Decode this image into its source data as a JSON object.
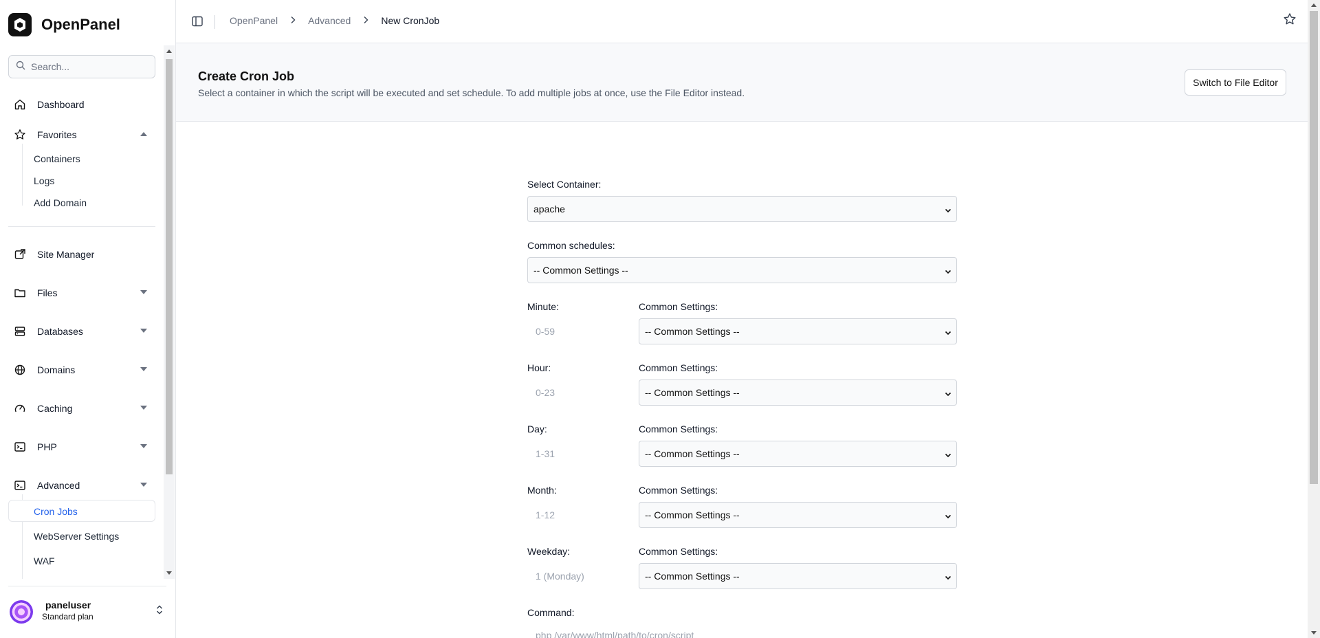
{
  "brand": {
    "name": "OpenPanel",
    "icon": "openpanel-logo-icon"
  },
  "search": {
    "placeholder": "Search..."
  },
  "nav": {
    "dashboard": "Dashboard",
    "favorites": "Favorites",
    "favorites_items": [
      "Containers",
      "Logs",
      "Add Domain"
    ],
    "site_manager": "Site Manager",
    "files": "Files",
    "databases": "Databases",
    "domains": "Domains",
    "caching": "Caching",
    "php": "PHP",
    "advanced": "Advanced",
    "advanced_items": [
      "Cron Jobs",
      "WebServer Settings",
      "WAF"
    ]
  },
  "user": {
    "name": "paneluser",
    "plan": "Standard plan"
  },
  "breadcrumb": [
    "OpenPanel",
    "Advanced",
    "New CronJob"
  ],
  "header": {
    "title": "Create Cron Job",
    "description": "Select a container in which the script will be executed and set schedule. To add multiple jobs at once, use the File Editor instead.",
    "switch_button": "Switch to File Editor"
  },
  "form": {
    "container_label": "Select Container:",
    "container_value": "apache",
    "common_schedules_label": "Common schedules:",
    "common_schedules_value": "-- Common Settings --",
    "common_settings_label": "Common Settings:",
    "common_settings_value": "-- Common Settings --",
    "minute": {
      "label": "Minute:",
      "placeholder": "0-59"
    },
    "hour": {
      "label": "Hour:",
      "placeholder": "0-23"
    },
    "day": {
      "label": "Day:",
      "placeholder": "1-31"
    },
    "month": {
      "label": "Month:",
      "placeholder": "1-12"
    },
    "weekday": {
      "label": "Weekday:",
      "placeholder": "1 (Monday)"
    },
    "command": {
      "label": "Command:",
      "placeholder": "php /var/www/html/path/to/cron/script"
    }
  },
  "colors": {
    "accent": "#2563eb",
    "border": "#e5e7eb"
  }
}
